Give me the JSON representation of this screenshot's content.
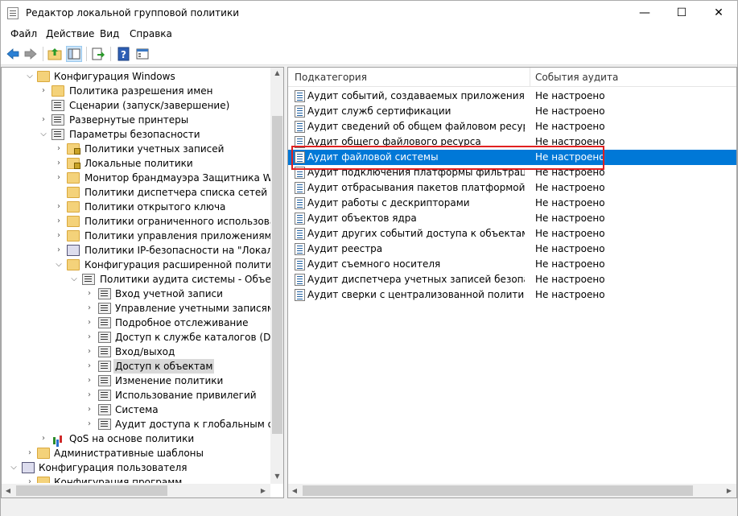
{
  "window": {
    "title": "Редактор локальной групповой политики",
    "minimize_glyph": "—",
    "maximize_glyph": "☐",
    "close_glyph": "✕"
  },
  "menu": [
    "Файл",
    "Действие",
    "Вид",
    "Справка"
  ],
  "toolbar_icons": [
    "back-arrow-icon",
    "forward-arrow-icon",
    "up-folder-icon",
    "show-hide-tree-icon",
    "export-list-icon",
    "help-icon",
    "properties-icon"
  ],
  "tree": {
    "items": [
      {
        "label": "Конфигурация Windows"
      },
      {
        "label": "Политика разрешения имен"
      },
      {
        "label": "Сценарии (запуск/завершение)"
      },
      {
        "label": "Развернутые принтеры"
      },
      {
        "label": "Параметры безопасности"
      },
      {
        "label": "Политики учетных записей"
      },
      {
        "label": "Локальные политики"
      },
      {
        "label": "Монитор брандмауэра Защитника Windo"
      },
      {
        "label": "Политики диспетчера списка сетей"
      },
      {
        "label": "Политики открытого ключа"
      },
      {
        "label": "Политики ограниченного использования"
      },
      {
        "label": "Политики управления приложениями"
      },
      {
        "label": "Политики IP-безопасности на \"Локальны"
      },
      {
        "label": "Конфигурация расширенной политики ау"
      },
      {
        "label": "Политики аудита системы - Объект ло"
      },
      {
        "label": "Вход учетной записи"
      },
      {
        "label": "Управление учетными записями"
      },
      {
        "label": "Подробное отслеживание"
      },
      {
        "label": "Доступ к службе каталогов (DS)"
      },
      {
        "label": "Вход/выход"
      },
      {
        "label": "Доступ к объектам"
      },
      {
        "label": "Изменение политики"
      },
      {
        "label": "Использование привилегий"
      },
      {
        "label": "Система"
      },
      {
        "label": "Аудит доступа к глобальным объе"
      },
      {
        "label": "QoS на основе политики"
      },
      {
        "label": "Административные шаблоны"
      },
      {
        "label": "Конфигурация пользователя"
      },
      {
        "label": "Конфигурация программ"
      }
    ]
  },
  "list": {
    "columns": [
      "Подкатегория",
      "События аудита"
    ],
    "rows": [
      {
        "name": "Аудит событий, создаваемых приложениями",
        "status": "Не настроено"
      },
      {
        "name": "Аудит служб сертификации",
        "status": "Не настроено"
      },
      {
        "name": "Аудит сведений об общем файловом ресурсе",
        "status": "Не настроено"
      },
      {
        "name": "Аудит общего файлового ресурса",
        "status": "Не настроено"
      },
      {
        "name": "Аудит файловой системы",
        "status": "Не настроено"
      },
      {
        "name": "Аудит подключения платформы фильтрации",
        "status": "Не настроено"
      },
      {
        "name": "Аудит отбрасывания пакетов платформой филь...",
        "status": "Не настроено"
      },
      {
        "name": "Аудит работы с дескрипторами",
        "status": "Не настроено"
      },
      {
        "name": "Аудит объектов ядра",
        "status": "Не настроено"
      },
      {
        "name": "Аудит других событий доступа к объектам",
        "status": "Не настроено"
      },
      {
        "name": "Аудит реестра",
        "status": "Не настроено"
      },
      {
        "name": "Аудит съемного носителя",
        "status": "Не настроено"
      },
      {
        "name": "Аудит диспетчера учетных записей безопасности",
        "status": "Не настроено"
      },
      {
        "name": "Аудит сверки с централизованной политикой д...",
        "status": "Не настроено"
      }
    ],
    "selected_index": 4
  },
  "colors": {
    "selection": "#0078d7",
    "highlight_box": "#e02020"
  }
}
